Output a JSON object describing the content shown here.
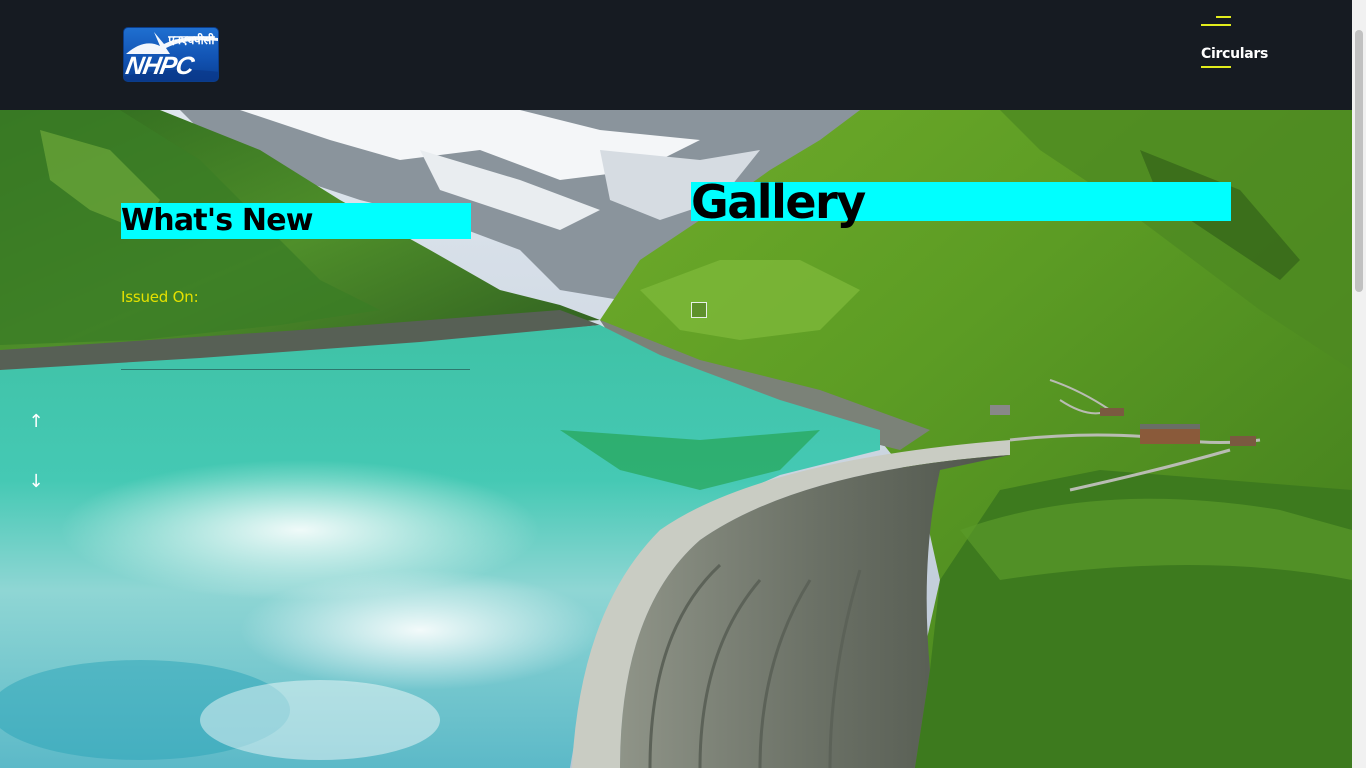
{
  "header": {
    "logo": {
      "hindi_text": "एनएचपीसी",
      "wordmark": "NHPC",
      "colors": {
        "background": "#1a5fc4",
        "text": "#ffffff"
      }
    },
    "nav": {
      "circulars_label": "Circulars",
      "accent_color": "#e2ec1c"
    }
  },
  "whats_new": {
    "title": "What's New",
    "issued_on_label": "Issued On:",
    "scroll_up_icon": "↑",
    "scroll_down_icon": "↓"
  },
  "gallery": {
    "title": "Gallery"
  },
  "colors": {
    "header_bg": "#161b22",
    "title_highlight": "#00ffff",
    "issued_on_text": "#e4e100"
  }
}
